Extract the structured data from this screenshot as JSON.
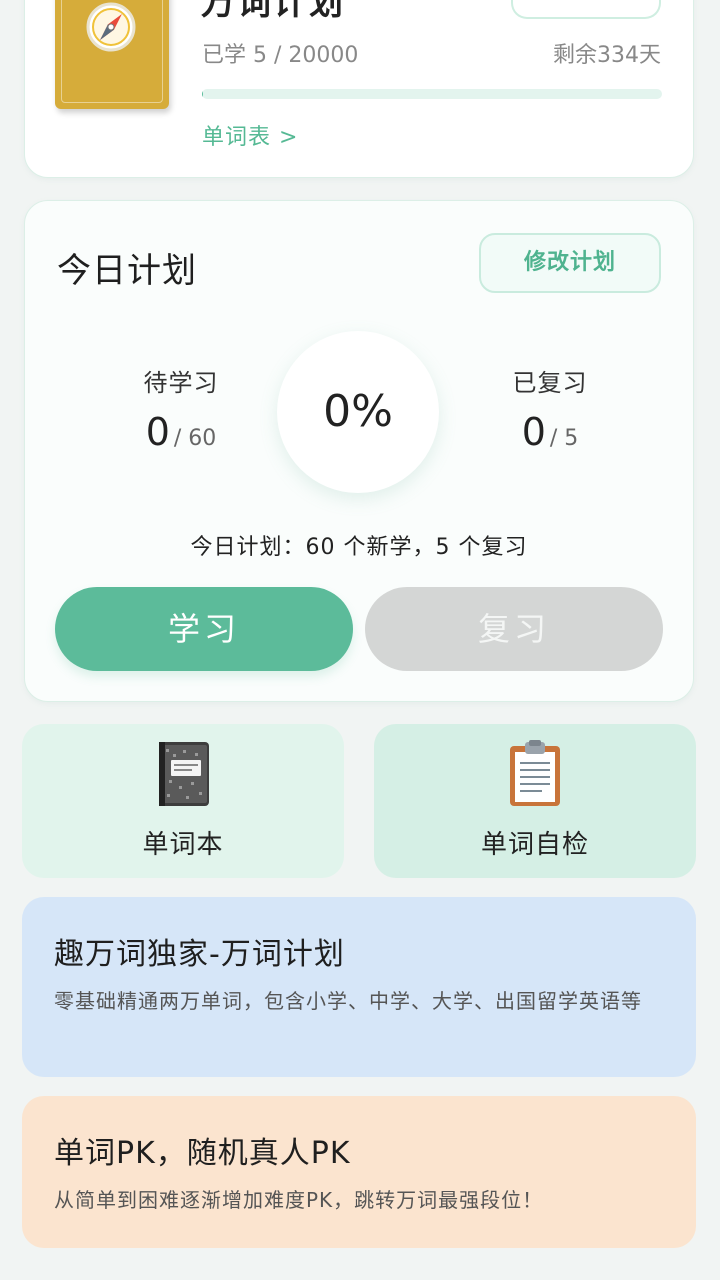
{
  "book": {
    "title": "万词计划",
    "learned": "已学 5 / 20000",
    "remaining": "剩余334天",
    "progress": 0.00025,
    "wordlist_link": "单词表 >"
  },
  "plan": {
    "title": "今日计划",
    "edit_label": "修改计划",
    "pending_label": "待学习",
    "pending_value": "0",
    "pending_total": "/ 60",
    "percent": "0%",
    "reviewed_label": "已复习",
    "reviewed_value": "0",
    "reviewed_total": "/ 5",
    "summary": "今日计划：60 个新学，5 个复习",
    "learn_button": "学习",
    "review_button": "复习"
  },
  "features": {
    "wordbook": {
      "label": "单词本",
      "icon": "notebook-icon"
    },
    "selfcheck": {
      "label": "单词自检",
      "icon": "clipboard-icon"
    }
  },
  "banners": {
    "plan": {
      "title": "趣万词独家-万词计划",
      "desc": "零基础精通两万单词，包含小学、中学、大学、出国留学英语等"
    },
    "pk": {
      "title": "单词PK，随机真人PK",
      "desc": "从简单到困难逐渐增加难度PK，跳转万词最强段位！"
    }
  },
  "colors": {
    "accent": "#5cbb9a",
    "disabled": "#d4d6d5",
    "plan_banner": "#d6e6f8",
    "pk_banner": "#fbe4cf"
  }
}
